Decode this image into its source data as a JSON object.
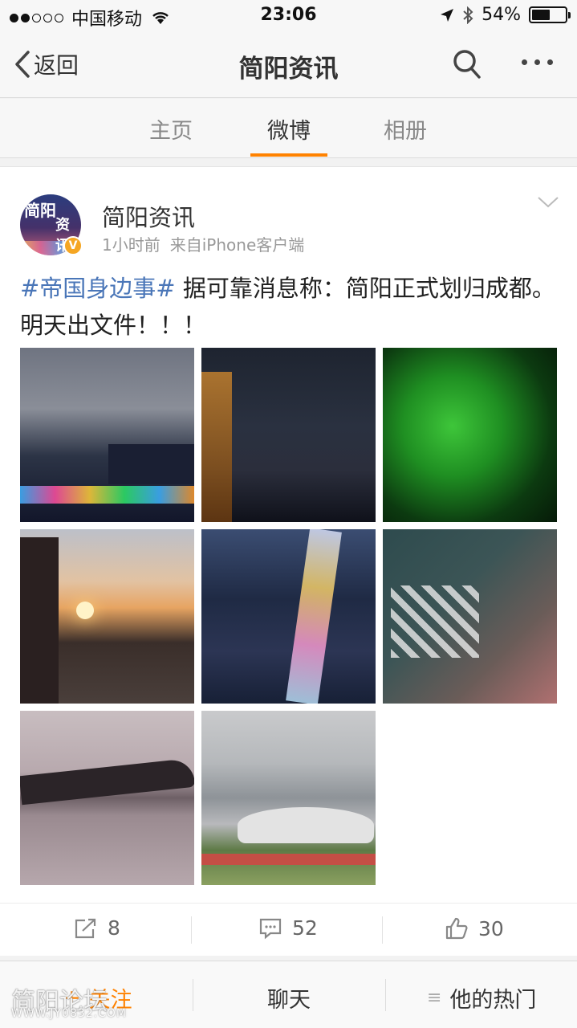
{
  "status_bar": {
    "carrier": "中国移动",
    "time": "23:06",
    "battery_percent": "54%",
    "battery_level": 0.54,
    "icons": [
      "signal-dots",
      "wifi-icon",
      "location-arrow-icon",
      "bluetooth-icon",
      "battery-icon"
    ]
  },
  "nav": {
    "back_label": "返回",
    "title": "简阳资讯",
    "icons": [
      "chevron-left-icon",
      "search-icon",
      "more-icon"
    ]
  },
  "tabs": [
    {
      "label": "主页",
      "active": false
    },
    {
      "label": "微博",
      "active": true
    },
    {
      "label": "相册",
      "active": false
    }
  ],
  "accent_color": "#ff8200",
  "link_color": "#4a76b8",
  "post": {
    "author": "简阳资讯",
    "avatar_text": "简阳",
    "avatar_text2": "资讯",
    "verified_badge": "V",
    "time": "1小时前",
    "source": "来自iPhone客户端",
    "hashtag": "#帝国身边事#",
    "text": " 据可靠消息称：简阳正式划归成都。明天出文件！！！",
    "photos": [
      "river-bridge-night",
      "dusk-skyline",
      "green-lit-tree",
      "sunset-river",
      "aerial-night-street",
      "aerial-crosswalk",
      "misty-river",
      "stadium-city"
    ]
  },
  "actions": {
    "repost_count": "8",
    "comment_count": "52",
    "like_count": "30"
  },
  "bottom_bar": {
    "follow_label": "关注",
    "follow_prefix": "+",
    "chat_label": "聊天",
    "hot_label": "他的热门",
    "hot_icon": "≡"
  },
  "watermark": {
    "text": "简阳论坛",
    "url": "WWW.JY0832.COM"
  }
}
